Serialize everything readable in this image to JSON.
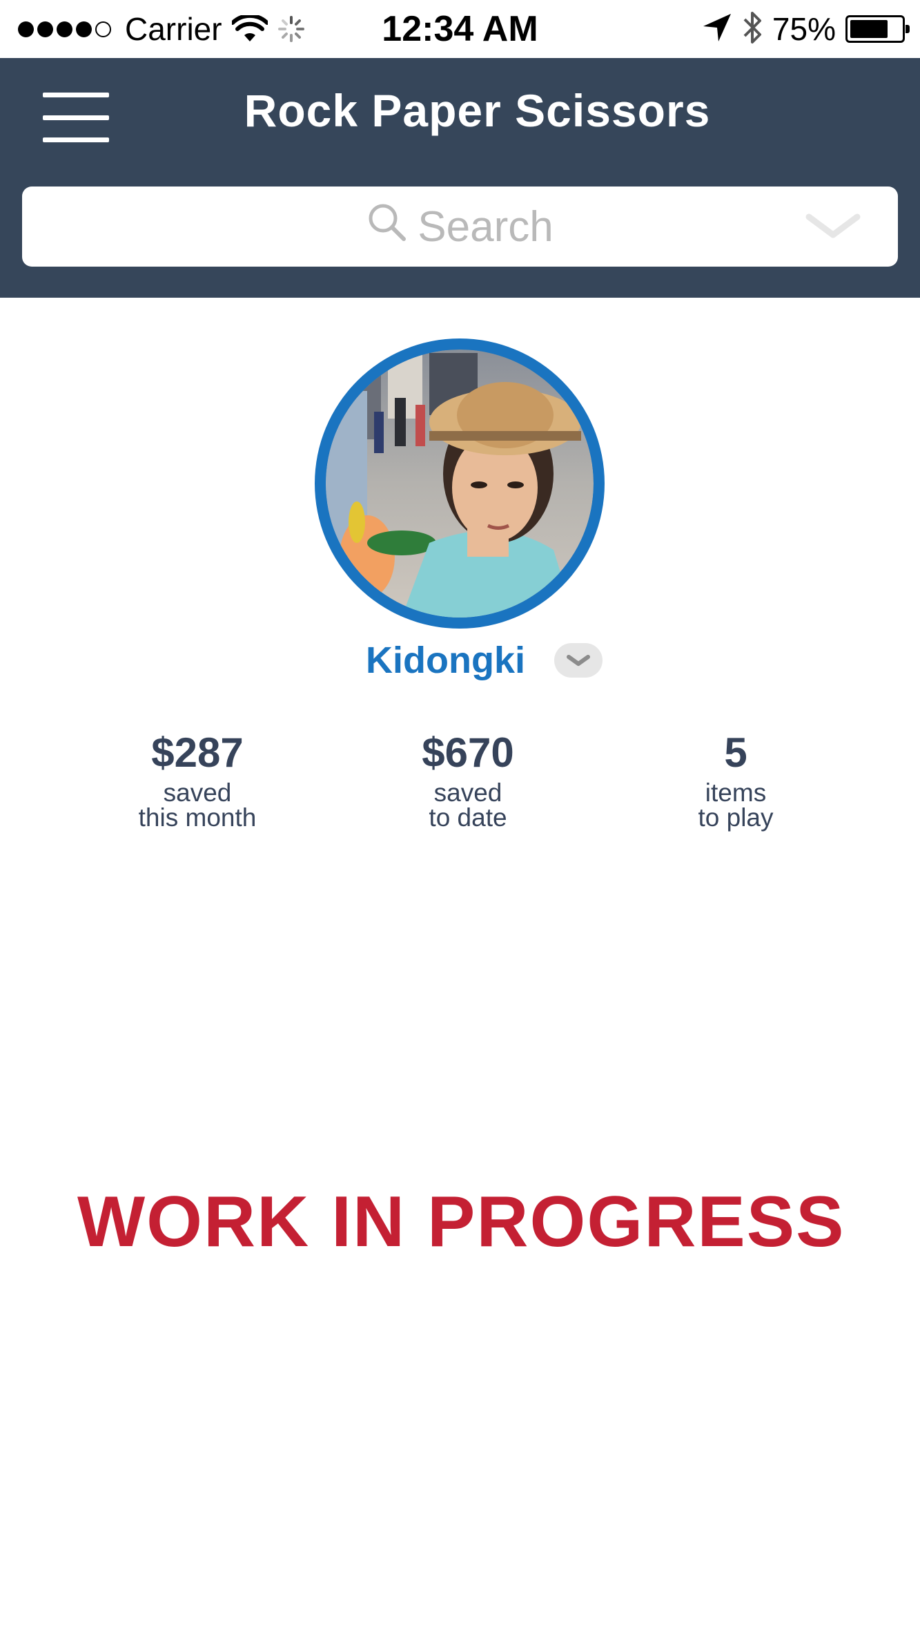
{
  "status_bar": {
    "carrier": "Carrier",
    "time": "12:34 AM",
    "battery_percent": "75%",
    "battery_level": 0.75,
    "signal_bars": 4,
    "signal_max": 5
  },
  "header": {
    "title": "Rock Paper Scissors",
    "menu_icon": "hamburger-menu-icon",
    "background_color": "#36465a"
  },
  "search": {
    "placeholder": "Search",
    "icon": "search-icon",
    "dropdown_icon": "chevron-down-icon"
  },
  "profile": {
    "name": "Kidongki",
    "accent_color": "#1a74c0"
  },
  "stats": [
    {
      "value": "$287",
      "label_line1": "saved",
      "label_line2": "this month"
    },
    {
      "value": "$670",
      "label_line1": "saved",
      "label_line2": "to date"
    },
    {
      "value": "5",
      "label_line1": "items",
      "label_line2": "to play"
    }
  ],
  "banner": {
    "text": "WORK IN PROGRESS",
    "color": "#c42033"
  }
}
